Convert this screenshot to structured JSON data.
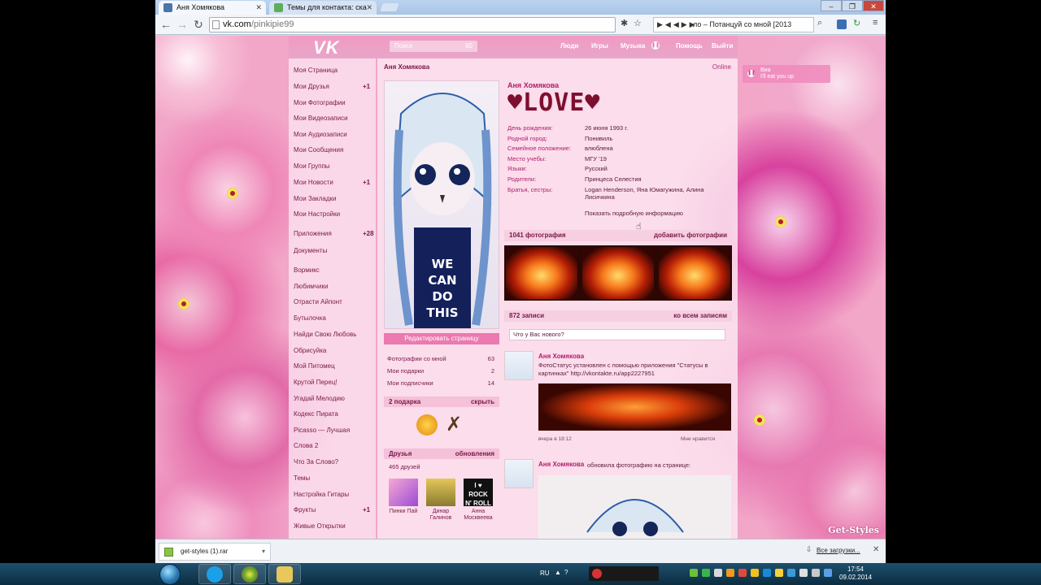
{
  "browser": {
    "tabs": [
      {
        "title": "Аня Хомякова"
      },
      {
        "title": "Темы для контакта: ска"
      }
    ],
    "url_host": "vk.com",
    "url_path": "/pinkipie99",
    "player_text": "ло – Потанцуй со мной [2013"
  },
  "vk": {
    "logo": "VK",
    "search_placeholder": "Поиск",
    "search_go": "60",
    "topnav": [
      "Люди",
      "Игры",
      "Музыка",
      "Помощь",
      "Выйти"
    ],
    "sidebar": [
      {
        "label": "Моя Страница",
        "count": ""
      },
      {
        "label": "Мои Друзья",
        "count": "+1"
      },
      {
        "label": "Мои Фотографии",
        "count": ""
      },
      {
        "label": "Мои Видеозаписи",
        "count": ""
      },
      {
        "label": "Мои Аудиозаписи",
        "count": ""
      },
      {
        "label": "Мои Сообщения",
        "count": ""
      },
      {
        "label": "Мои Группы",
        "count": ""
      },
      {
        "label": "Мои Новости",
        "count": "+1"
      },
      {
        "label": "Мои Закладки",
        "count": ""
      },
      {
        "label": "Мои Настройки",
        "count": ""
      },
      {
        "label": "Приложения",
        "count": "+28"
      },
      {
        "label": "Документы",
        "count": ""
      },
      {
        "label": "Вормикс",
        "count": ""
      },
      {
        "label": "Любимчики",
        "count": ""
      },
      {
        "label": "Отрасти Айпонт",
        "count": ""
      },
      {
        "label": "Бутылочка",
        "count": ""
      },
      {
        "label": "Найди Свою Любовь",
        "count": ""
      },
      {
        "label": "Обрисуйка",
        "count": ""
      },
      {
        "label": "Мой Питомец",
        "count": ""
      },
      {
        "label": "Крутой Перец!",
        "count": ""
      },
      {
        "label": "Угадай Мелодию",
        "count": ""
      },
      {
        "label": "Кодекс Пирата",
        "count": ""
      },
      {
        "label": "Picasso — Лучшая",
        "count": ""
      },
      {
        "label": "Слова 2",
        "count": ""
      },
      {
        "label": "Что За Слово?",
        "count": ""
      },
      {
        "label": "Темы",
        "count": ""
      },
      {
        "label": "Настройка Гитары",
        "count": ""
      },
      {
        "label": "Фрукты",
        "count": "+1"
      },
      {
        "label": "Живые Открытки",
        "count": ""
      }
    ],
    "profile": {
      "page_name": "Аня Хомякова",
      "status": "Online",
      "full_name": "Аня Хомякова",
      "status_text": "♥LOVE♥",
      "edit_button": "Редактировать страницу",
      "stats": [
        {
          "label": "Фотографии со мной",
          "value": "63"
        },
        {
          "label": "Мои подарки",
          "value": "2"
        },
        {
          "label": "Мои подписчики",
          "value": "14"
        }
      ],
      "gifts_header": "2 подарка",
      "gifts_hide": "скрыть",
      "friends_header": "Друзья",
      "friends_updates": "обновления",
      "friends_count": "465 друзей",
      "friends": [
        {
          "name": "Пинки Пай"
        },
        {
          "name": "Динар Галинов"
        },
        {
          "name": "Анна Москвеева"
        }
      ],
      "info": [
        {
          "label": "День рождения:",
          "value": "26 июня 1993 г."
        },
        {
          "label": "Родной город:",
          "value": "Понивиль"
        },
        {
          "label": "Семейное положение:",
          "value": "влюблена"
        },
        {
          "label": "Место учебы:",
          "value": "МГУ '19"
        },
        {
          "label": "Языки:",
          "value": "Русский"
        },
        {
          "label": "Родители:",
          "value": "Принцеса Селестия"
        },
        {
          "label": "Братья, сестры:",
          "value": "Logan Henderson, Яна Юмагужина, Алина Лисичкина"
        }
      ],
      "show_more": "Показать подробную информацию",
      "photos_header": "1041 фотография",
      "photos_add": "добавить фотографии",
      "wall_header": "872 записи",
      "wall_all": "ко всем записям",
      "post_placeholder": "Что у Вас нового?",
      "posts": [
        {
          "author": "Аня Хомякова",
          "text": "ФотоСтатус установлен с помощью приложения \"Статусы в картинках\" http://vkontakte.ru/app2227951",
          "date": "вчера в 18:12",
          "like": "Мне нравится"
        },
        {
          "author": "Аня Хомякова",
          "text": "обновила фотографию на странице:"
        }
      ]
    },
    "notification": {
      "title": "Виа",
      "subtitle": "I'll eat you up"
    },
    "watermark": "Get-Styles"
  },
  "downloads": {
    "file": "get-styles (1).rar",
    "all_link": "Все загрузки..."
  },
  "taskbar": {
    "lang": "RU",
    "time": "17:54",
    "date": "09.02.2014"
  }
}
